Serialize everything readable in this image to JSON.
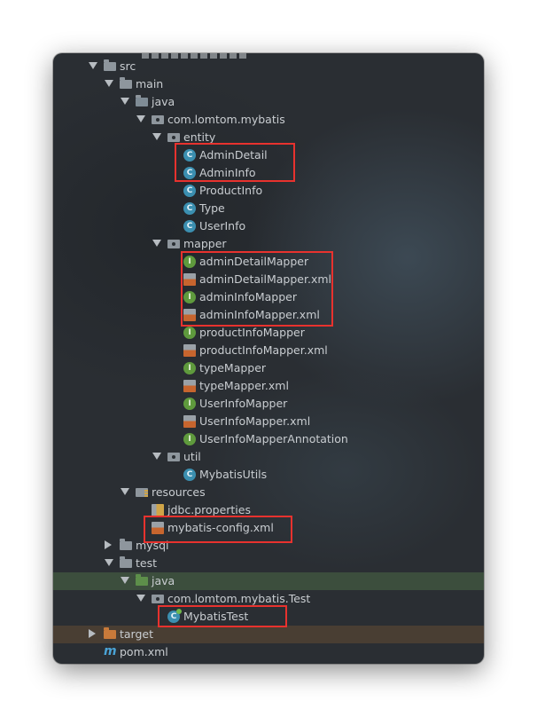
{
  "tree": {
    "rows": [
      {
        "label": "src",
        "icon": "folder-icon",
        "arrow": "down",
        "depth": 0
      },
      {
        "label": "main",
        "icon": "folder-icon",
        "arrow": "down",
        "depth": 1
      },
      {
        "label": "java",
        "icon": "source-folder-icon",
        "arrow": "down",
        "depth": 2
      },
      {
        "label": "com.lomtom.mybatis",
        "icon": "package-icon",
        "arrow": "down",
        "depth": 3
      },
      {
        "label": "entity",
        "icon": "package-icon",
        "arrow": "down",
        "depth": 4
      },
      {
        "label": "AdminDetail",
        "icon": "class-icon",
        "depth": 5
      },
      {
        "label": "AdminInfo",
        "icon": "class-icon",
        "depth": 5
      },
      {
        "label": "ProductInfo",
        "icon": "class-icon",
        "depth": 5
      },
      {
        "label": "Type",
        "icon": "class-icon",
        "depth": 5
      },
      {
        "label": "UserInfo",
        "icon": "class-icon",
        "depth": 5
      },
      {
        "label": "mapper",
        "icon": "package-icon",
        "arrow": "down",
        "depth": 4
      },
      {
        "label": "adminDetailMapper",
        "icon": "interface-icon",
        "depth": 5
      },
      {
        "label": "adminDetailMapper.xml",
        "icon": "xml-file-icon",
        "depth": 5
      },
      {
        "label": "adminInfoMapper",
        "icon": "interface-icon",
        "depth": 5
      },
      {
        "label": "adminInfoMapper.xml",
        "icon": "xml-file-icon",
        "depth": 5
      },
      {
        "label": "productInfoMapper",
        "icon": "interface-icon",
        "depth": 5
      },
      {
        "label": "productInfoMapper.xml",
        "icon": "xml-file-icon",
        "depth": 5
      },
      {
        "label": "typeMapper",
        "icon": "interface-icon",
        "depth": 5
      },
      {
        "label": "typeMapper.xml",
        "icon": "xml-file-icon",
        "depth": 5
      },
      {
        "label": "UserInfoMapper",
        "icon": "interface-icon",
        "depth": 5
      },
      {
        "label": "UserInfoMapper.xml",
        "icon": "xml-file-icon",
        "depth": 5
      },
      {
        "label": "UserInfoMapperAnnotation",
        "icon": "interface-icon",
        "depth": 5
      },
      {
        "label": "util",
        "icon": "package-icon",
        "arrow": "down",
        "depth": 4
      },
      {
        "label": "MybatisUtils",
        "icon": "class-icon",
        "depth": 5
      },
      {
        "label": "resources",
        "icon": "resources-folder-icon",
        "arrow": "down",
        "depth": 2
      },
      {
        "label": "jdbc.properties",
        "icon": "properties-file-icon",
        "depth": 3
      },
      {
        "label": "mybatis-config.xml",
        "icon": "xml-file-icon",
        "depth": 3
      },
      {
        "label": "mysql",
        "icon": "folder-icon",
        "arrow": "right",
        "depth": 1
      },
      {
        "label": "test",
        "icon": "folder-icon",
        "arrow": "down",
        "depth": 1
      },
      {
        "label": "java",
        "icon": "test-source-folder-icon",
        "arrow": "down",
        "depth": 2,
        "highlight": "green"
      },
      {
        "label": "com.lomtom.mybatis.Test",
        "icon": "package-icon",
        "arrow": "down",
        "depth": 3
      },
      {
        "label": "MybatisTest",
        "icon": "test-class-icon",
        "depth": 4
      },
      {
        "label": "target",
        "icon": "excluded-folder-icon",
        "arrow": "right",
        "depth": 0,
        "highlight": "brown"
      },
      {
        "label": "pom.xml",
        "icon": "maven-icon",
        "depth": 0
      }
    ]
  },
  "colors": {
    "highlight_box": "#e8322e",
    "background": "#2a2e33"
  }
}
